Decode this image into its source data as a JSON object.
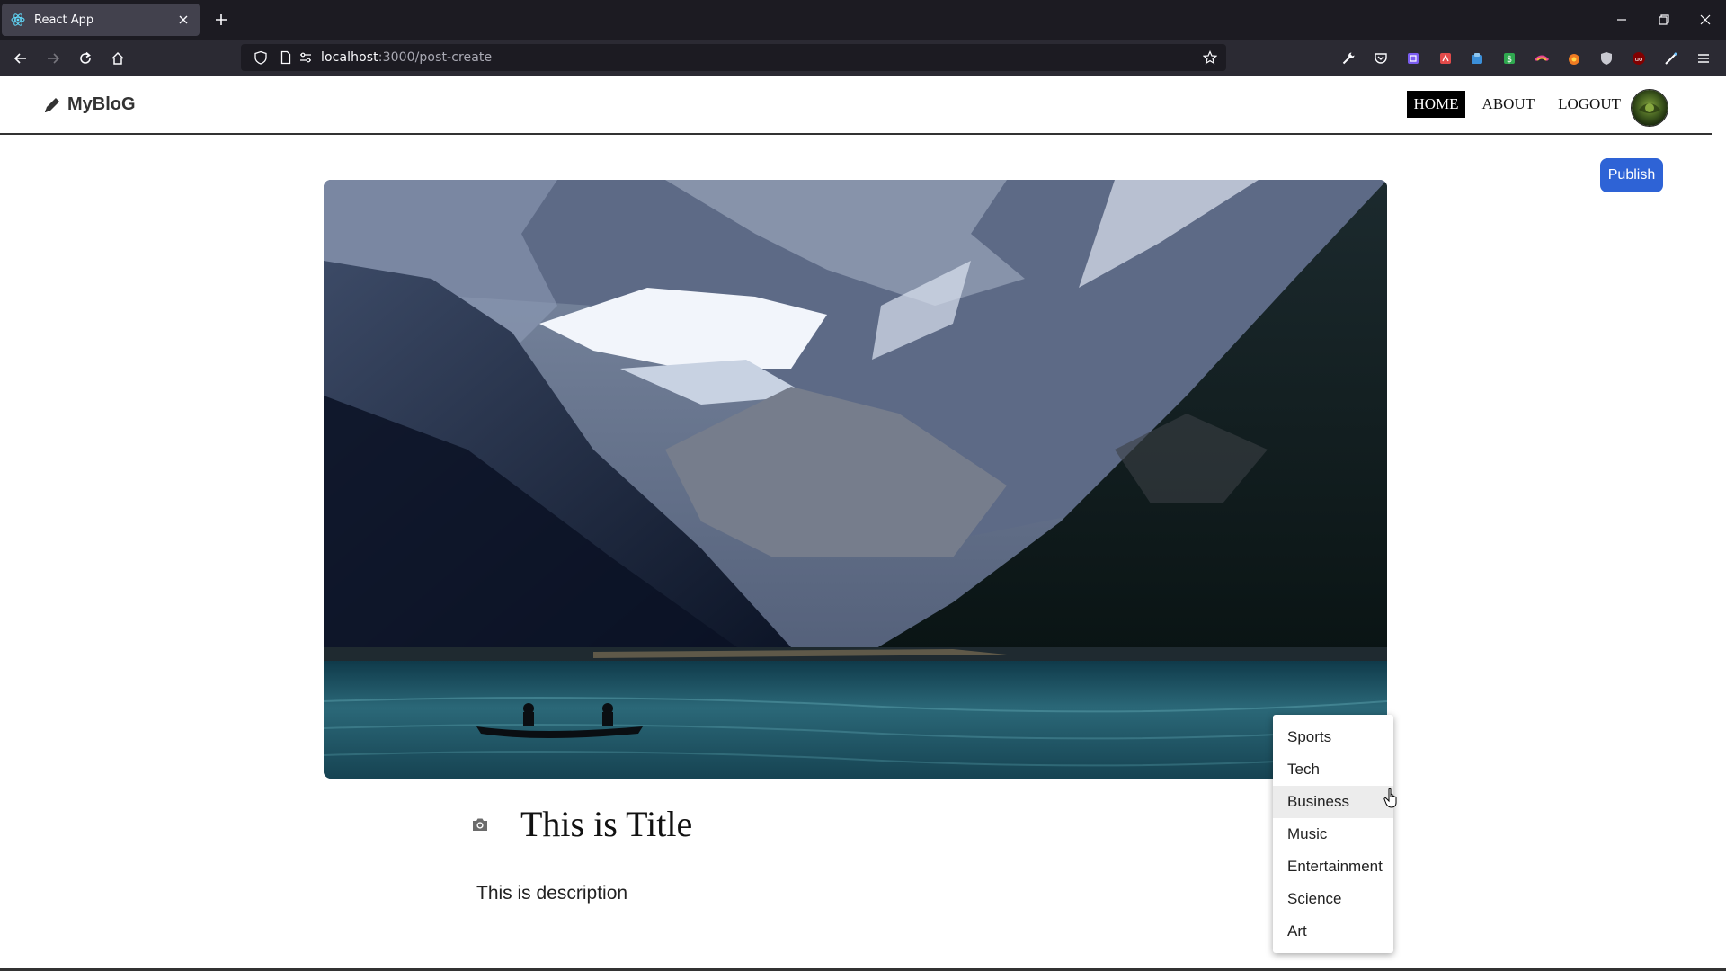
{
  "browser": {
    "tab_title": "React App",
    "url_host": "localhost",
    "url_rest": ":3000/post-create",
    "icons": [
      "react-favicon",
      "close-icon",
      "plus-icon",
      "minimize-icon",
      "restore-icon",
      "close-window-icon",
      "back-arrow-icon",
      "forward-arrow-icon",
      "reload-icon",
      "home-icon",
      "shield-icon",
      "page-icon",
      "permissions-icon",
      "star-icon",
      "wrench-icon",
      "pocket-icon",
      "menu-icon"
    ]
  },
  "site": {
    "logo_text": "MyBloG",
    "menu": {
      "home": "HOME",
      "about": "ABOUT",
      "logout": "LOGOUT"
    },
    "publish_label": "Publish",
    "accent_color": "#2e63d6"
  },
  "post": {
    "title": "This is Title",
    "description": "This is description"
  },
  "category_dropdown": {
    "options": [
      "Sports",
      "Tech",
      "Business",
      "Music",
      "Entertainment",
      "Science",
      "Art"
    ],
    "hovered": "Business"
  }
}
